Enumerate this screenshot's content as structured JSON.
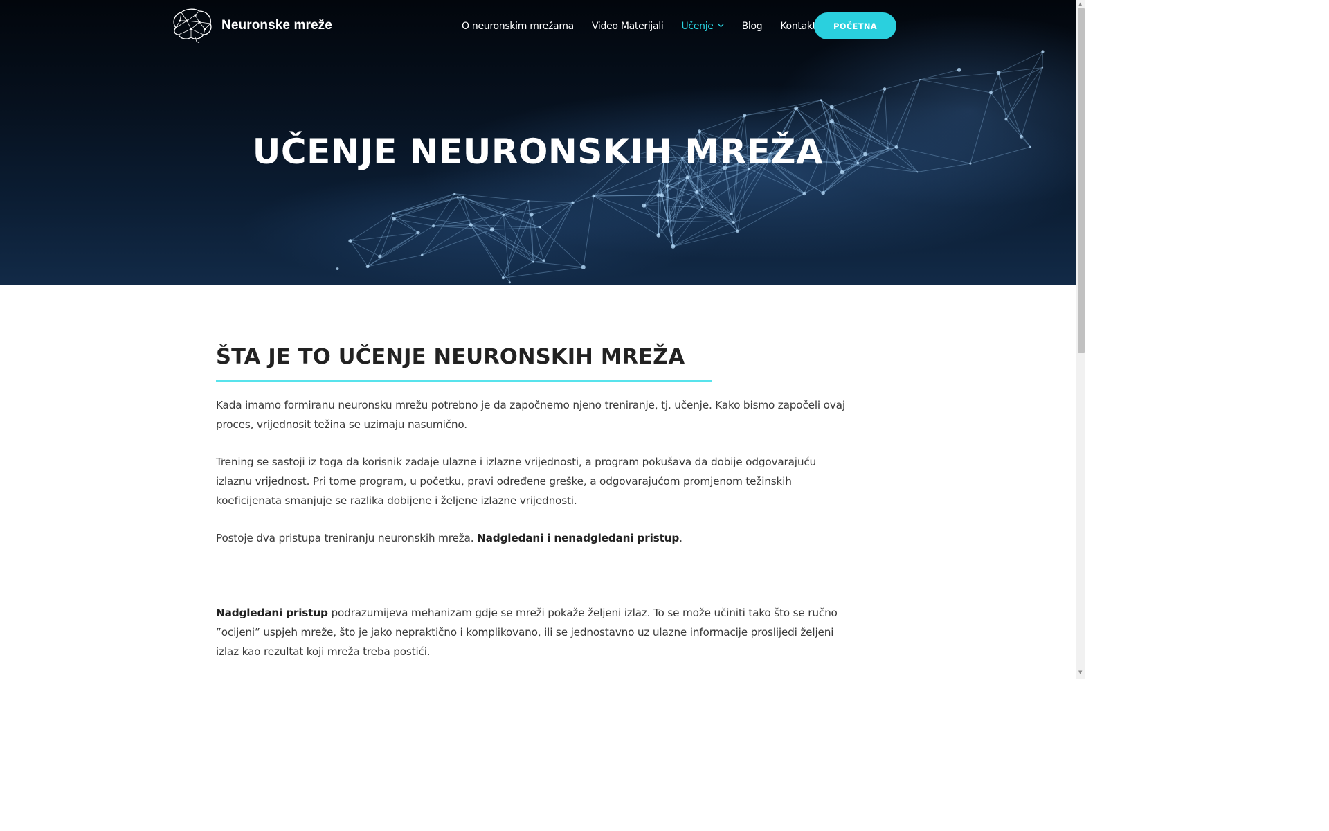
{
  "site": {
    "title": "Neuronske mreže"
  },
  "nav": {
    "items": [
      {
        "label": "O neuronskim mrežama"
      },
      {
        "label": "Video Materijali"
      },
      {
        "label": "Učenje"
      },
      {
        "label": "Blog"
      },
      {
        "label": "Kontakt"
      }
    ],
    "cta_label": "POČETNA"
  },
  "hero": {
    "title": "UČENJE NEURONSKIH MREŽA"
  },
  "main": {
    "section_title": "ŠTA JE TO UČENJE NEURONSKIH MREŽA",
    "p1": "Kada imamo formiranu neuronsku mrežu potrebno je da započnemo njeno treniranje, tj. učenje. Kako bismo započeli ovaj proces, vrijednosit težina se uzimaju nasumično.",
    "p2": "Trening se sastoji iz toga da korisnik zadaje ulazne i izlazne vrijednosti, a program pokušava da dobije odgovarajuću izlaznu vrijednost. Pri tome program, u početku, pravi određene greške, a odgovarajućom promjenom težinskih koeficijenata smanjuje se razlika dobijene i željene izlazne vrijednosti.",
    "p3_text": "Postoje dva pristupa treniranju neuronskih mreža. ",
    "p3_bold": "Nadgledani i nenadgledani pristup",
    "p3_end": ".",
    "p4_bold": "Nadgledani pristup",
    "p4_text": " podrazumijeva mehanizam gdje se mreži pokaže željeni izlaz. To se može učiniti tako što se ručno ”ocijeni” uspjeh mreže, što je jako nepraktično i komplikovano, ili se jednostavno uz ulazne informacije proslijedi željeni izlaz kao rezultat koji mreža treba postići."
  },
  "colors": {
    "accent": "#2ad0de",
    "rule": "#58e3ec",
    "hero_bg": "#06101d"
  },
  "icons": {
    "logo": "brain-network-icon",
    "dropdown": "chevron-down-icon"
  }
}
